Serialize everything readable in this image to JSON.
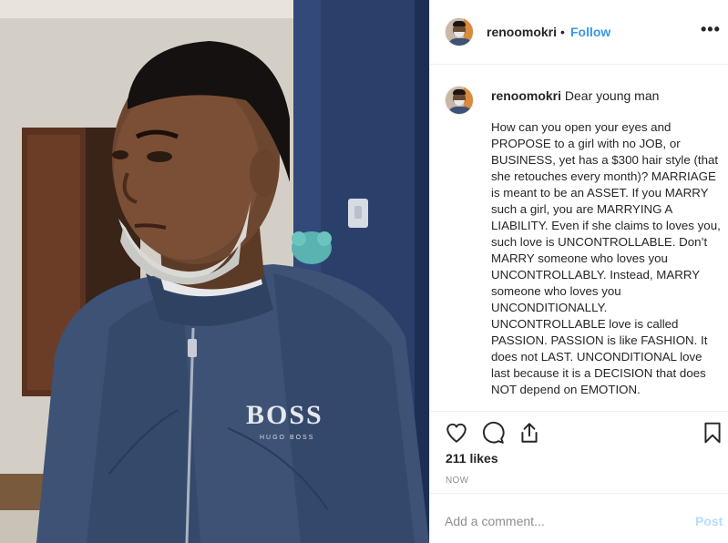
{
  "post": {
    "username": "renoomokri",
    "separator": "•",
    "follow_label": "Follow",
    "more_label": "•••",
    "photo": {
      "jacket_logo_main": "BOSS",
      "jacket_logo_sub": "HUGO BOSS"
    },
    "caption": {
      "username": "renoomokri",
      "title": "Dear young man",
      "text": "How can you open your eyes and PROPOSE to a girl with no JOB, or BUSINESS, yet has a $300 hair style (that she retouches every month)? MARRIAGE is meant to be an ASSET. If you MARRY such a girl, you are MARRYING A LIABILITY. Even if she claims to loves you, such love is UNCONTROLLABLE. Don’t MARRY someone who loves you UNCONTROLLABLY. Instead, MARRY someone who loves you UNCONDITIONALLY. UNCONTROLLABLE love is called PASSION. PASSION is like FASHION. It does not LAST. UNCONDITIONAL love last because it is a DECISION that does NOT depend on EMOTION."
    },
    "actions": {
      "like_icon": "heart-icon",
      "comment_icon": "comment-bubble-icon",
      "share_icon": "share-icon",
      "save_icon": "bookmark-icon"
    },
    "likes_text": "211 likes",
    "timestamp": "NOW",
    "comment_box": {
      "placeholder": "Add a comment...",
      "post_label": "Post"
    },
    "colors": {
      "link_blue": "#3897f0",
      "post_disabled": "#b2dffc",
      "muted": "#8e8e8e",
      "jacket": "#3d5275"
    }
  }
}
